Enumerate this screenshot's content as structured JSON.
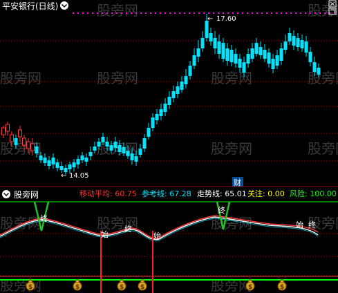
{
  "colors": {
    "bg": "#000000",
    "up": "#ff3a3a",
    "down": "#00e5ff",
    "grid": "#8b1010",
    "white": "#ffffff",
    "yellow": "#ffff00",
    "magenta": "#ff00ff",
    "green": "#23c523",
    "lime": "#00ff00",
    "signal_red": "#ff2020",
    "ref_line": "#e04040"
  },
  "header": {
    "stock_title": "平安银行(日线)",
    "collapse_icon": "chevron-down-icon",
    "window_buttons": [
      "close-icon",
      "restore-icon"
    ]
  },
  "price_chart": {
    "high_label": "17.60",
    "low_label": "14.05",
    "arrow_glyph": "←",
    "cai_marker": "财"
  },
  "indicator": {
    "name": "股旁网",
    "collapse_icon": "chevron-down-icon",
    "values": [
      {
        "label": "移动平均:",
        "value": "60.75",
        "color": "#ff3030"
      },
      {
        "label": "参考线:",
        "value": "67.28",
        "color": "#00e5ff"
      },
      {
        "label": "走势线:",
        "value": "65.01",
        "color": "#ffffff"
      },
      {
        "label": "关注:",
        "value": "0.00",
        "color": "#ffff00"
      },
      {
        "label": "风险:",
        "value": "100.00",
        "color": "#00ff00"
      }
    ],
    "labels": {
      "start": "始",
      "end": "终"
    },
    "money_bag_glyph": "$"
  },
  "watermark": "股旁网",
  "chart_data": {
    "type": "candlestick",
    "y_high": 17.6,
    "y_low": 14.05,
    "indicator_values": {
      "ma": 60.75,
      "reference": 67.28,
      "trend": 65.01,
      "attention": 0.0,
      "risk": 100.0
    }
  }
}
